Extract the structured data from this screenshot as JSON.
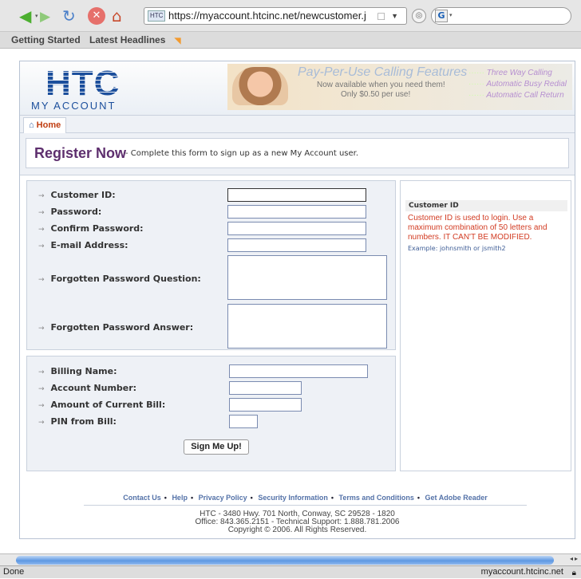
{
  "browser": {
    "url": "https://myaccount.htcinc.net/newcustomer.j",
    "site_icon": "HTC",
    "search_value": "",
    "bookmarks": [
      "Getting Started",
      "Latest Headlines"
    ],
    "status_left": "Done",
    "status_right": "myaccount.htcinc.net"
  },
  "header": {
    "logo_text": "HTC",
    "logo_subtitle": "MY ACCOUNT",
    "promo_title": "Pay-Per-Use Calling Features",
    "promo_line1": "Now available when you need them!",
    "promo_line2": "Only $0.50 per use!",
    "promo_features": [
      "Three Way Calling",
      "Automatic Busy Redial",
      "Automatic Call Return"
    ]
  },
  "nav": {
    "home_tab": "Home"
  },
  "register": {
    "title": "Register Now",
    "subtitle": "- Complete this form to sign up as a new My Account user."
  },
  "form": {
    "customer_id": {
      "label": "Customer ID:",
      "value": ""
    },
    "password": {
      "label": "Password:",
      "value": ""
    },
    "confirm_password": {
      "label": "Confirm Password:",
      "value": ""
    },
    "email": {
      "label": "E-mail Address:",
      "value": ""
    },
    "question": {
      "label": "Forgotten Password Question:",
      "value": ""
    },
    "answer": {
      "label": "Forgotten Password Answer:",
      "value": ""
    },
    "billing_name": {
      "label": "Billing Name:",
      "value": ""
    },
    "account_number": {
      "label": "Account Number:",
      "value": ""
    },
    "amount_bill": {
      "label": "Amount of Current Bill:",
      "value": ""
    },
    "pin": {
      "label": "PIN from Bill:",
      "value": ""
    },
    "submit_label": "Sign Me Up!"
  },
  "help": {
    "heading": "Customer ID",
    "text": "Customer ID is used to login. Use a maximum combination of 50 letters and numbers. IT CAN'T BE MODIFIED.",
    "example": "Example: johnsmith or jsmith2"
  },
  "footer": {
    "links": [
      "Contact Us",
      "Help",
      "Privacy Policy",
      "Security Information",
      "Terms and Conditions",
      "Get Adobe Reader"
    ],
    "address1": "HTC - 3480 Hwy. 701 North, Conway, SC 29528 - 1820",
    "address2": "Office: 843.365.2151 - Technical Support: 1.888.781.2006",
    "address3": "Copyright © 2006. All Rights Reserved."
  },
  "icons": {
    "back": "left-arrow",
    "forward": "right-arrow",
    "reload": "reload",
    "stop": "stop",
    "home": "house",
    "accent_purple": "#5e2f6e",
    "help_red": "#d23b22",
    "link_blue": "#5472a8"
  }
}
